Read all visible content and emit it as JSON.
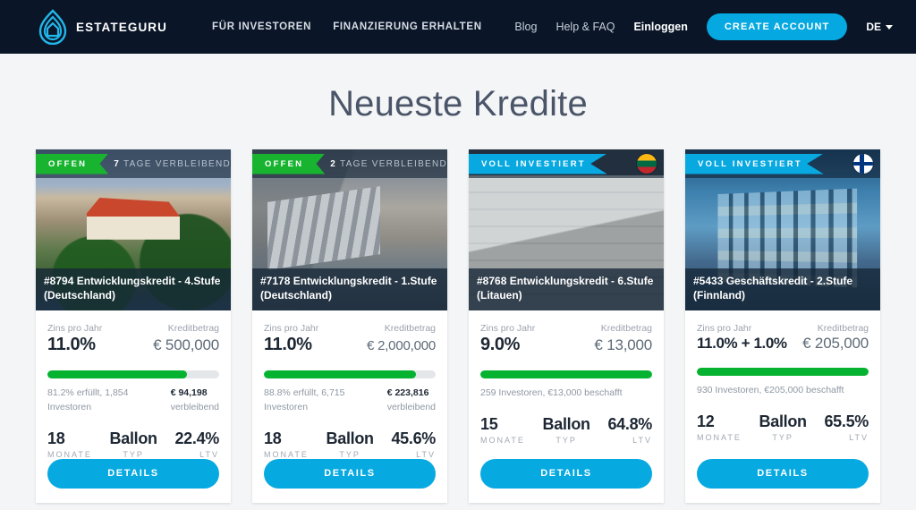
{
  "navbar": {
    "brand": "ESTATEGURU",
    "left_links": [
      {
        "label": "FÜR INVESTOREN"
      },
      {
        "label": "FINANZIERUNG ERHALTEN"
      }
    ],
    "right_links": [
      {
        "label": "Blog"
      },
      {
        "label": "Help & FAQ"
      }
    ],
    "login_label": "Einloggen",
    "cta_label": "CREATE ACCOUNT",
    "language": "DE",
    "accent_color": "#05a8e0",
    "background_color": "#0a1628"
  },
  "page": {
    "title": "Neueste Kredite",
    "background_color": "#f4f5f7"
  },
  "labels": {
    "rate_label": "Zins pro Jahr",
    "amount_label": "Kreditbetrag",
    "months_key": "MONATE",
    "type_key": "TYP",
    "ltv_key": "LTV",
    "details_label": "DETAILS"
  },
  "colors": {
    "status_open": "#18b430",
    "status_funded": "#08a9e1",
    "progress_fill": "#06b331",
    "button": "#06a9e0"
  },
  "cards": [
    {
      "status": "OFFEN",
      "status_type": "open",
      "days_left_number": "7",
      "days_left_text": "TAGE VERBLEIBEND",
      "flag": "flag-de",
      "flag_name": "germany-flag-icon",
      "title": "#8794 Entwicklungskredit - 4.Stufe (Deutschland)",
      "rate": "11.0%",
      "amount": "€ 500,000",
      "progress_percent": 81.2,
      "funding_text": "81.2% erfüllt, 1,854 Investoren",
      "remaining_amount": "€ 94,198",
      "remaining_label": "verbleibend",
      "months": "18",
      "type": "Ballon",
      "ltv": "22.4%"
    },
    {
      "status": "OFFEN",
      "status_type": "open",
      "days_left_number": "2",
      "days_left_text": "TAGE VERBLEIBEND",
      "flag": "flag-de",
      "flag_name": "germany-flag-icon",
      "title": "#7178 Entwicklungskredit - 1.Stufe (Deutschland)",
      "rate": "11.0%",
      "amount": "€ 2,000,000",
      "progress_percent": 88.8,
      "funding_text": "88.8% erfüllt, 6,715 Investoren",
      "remaining_amount": "€ 223,816",
      "remaining_label": "verbleibend",
      "months": "18",
      "type": "Ballon",
      "ltv": "45.6%"
    },
    {
      "status": "VOLL INVESTIERT",
      "status_type": "funded",
      "days_left_number": "",
      "days_left_text": "",
      "flag": "flag-lt",
      "flag_name": "lithuania-flag-icon",
      "title": "#8768 Entwicklungskredit - 6.Stufe (Litauen)",
      "rate": "9.0%",
      "amount": "€ 13,000",
      "progress_percent": 100,
      "funding_text": "259 Investoren, €13,000 beschafft",
      "remaining_amount": "",
      "remaining_label": "",
      "months": "15",
      "type": "Ballon",
      "ltv": "64.8%"
    },
    {
      "status": "VOLL INVESTIERT",
      "status_type": "funded",
      "days_left_number": "",
      "days_left_text": "",
      "flag": "flag-fi",
      "flag_name": "finland-flag-icon",
      "title": "#5433 Geschäftskredit - 2.Stufe (Finnland)",
      "rate": "11.0% + 1.0%",
      "amount": "€ 205,000",
      "progress_percent": 100,
      "funding_text": "930 Investoren, €205,000 beschafft",
      "remaining_amount": "",
      "remaining_label": "",
      "months": "12",
      "type": "Ballon",
      "ltv": "65.5%"
    }
  ]
}
